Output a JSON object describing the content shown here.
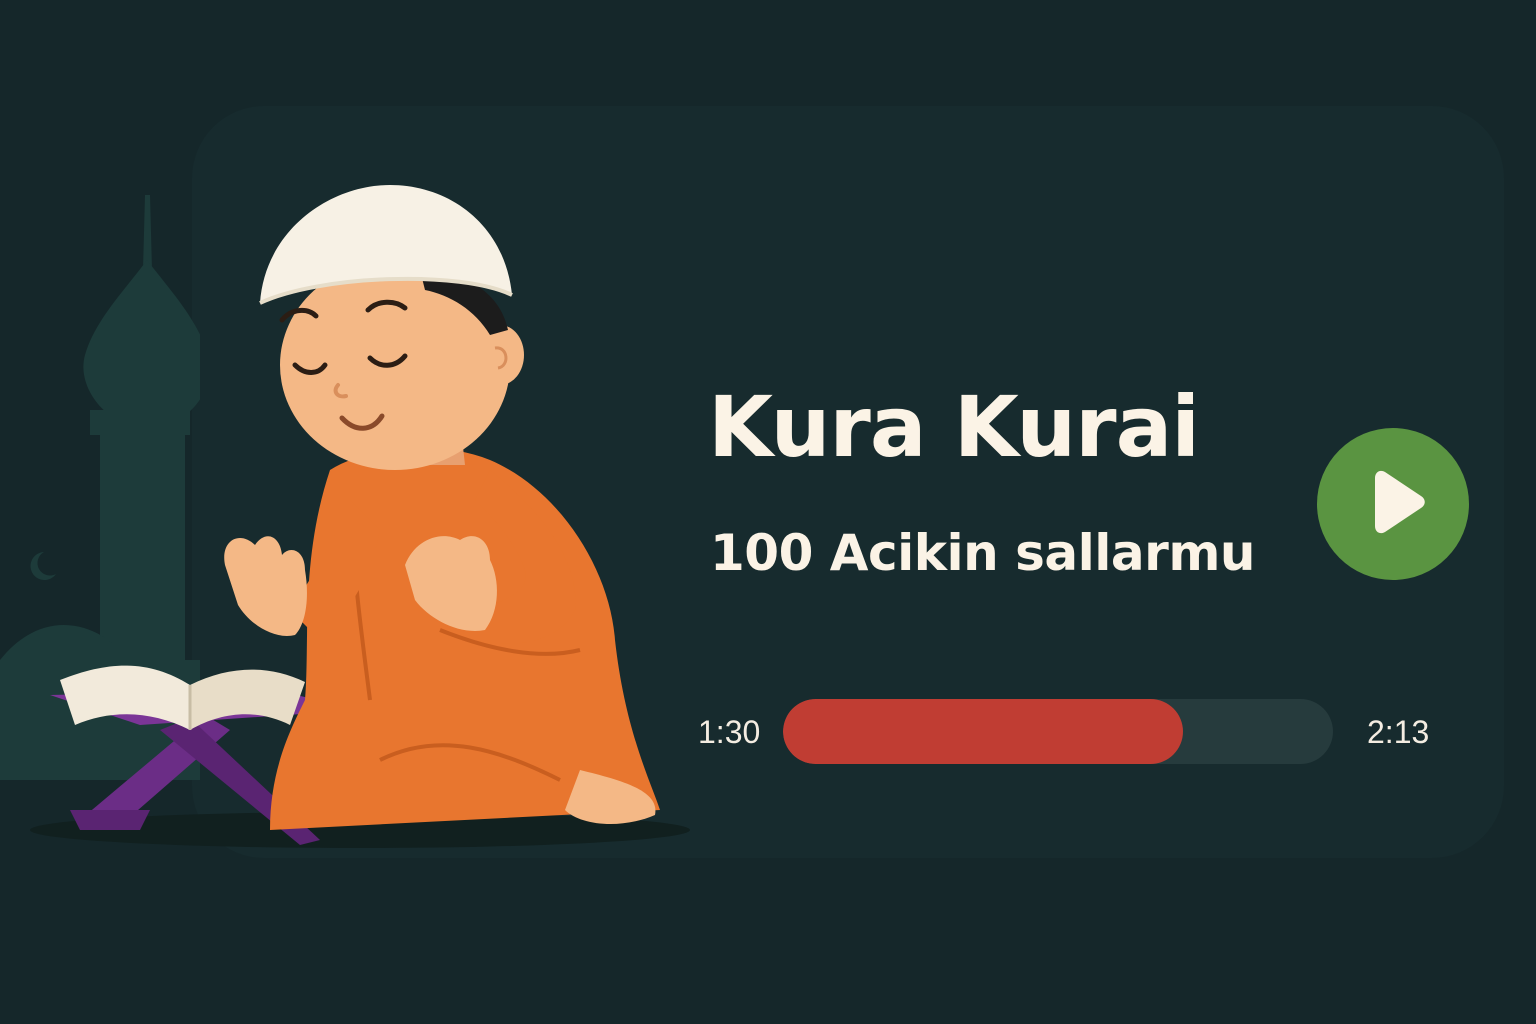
{
  "player": {
    "title": "Kura Kurai",
    "subtitle": "100 Acikin sallarmu",
    "elapsed": "1:30",
    "total": "2:13",
    "progress_fraction": 0.727,
    "play_icon": "play-icon"
  },
  "colors": {
    "background": "#15272a",
    "card": "#172b2e",
    "text": "#fbf3e6",
    "play_button": "#5a9441",
    "progress_fill": "#c03d33",
    "progress_track": "#263b3d",
    "robe": "#e8762f",
    "cap": "#f7f1e5",
    "book_stand": "#6b2d86"
  }
}
